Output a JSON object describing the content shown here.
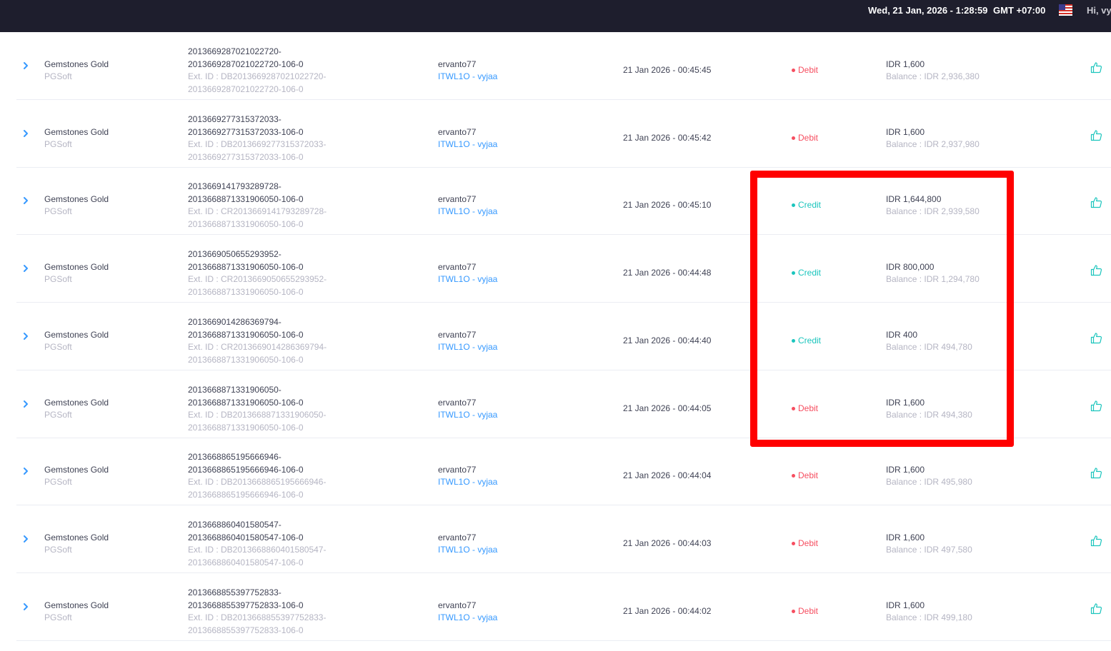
{
  "header": {
    "datetime": "Wed, 21 Jan, 2026 - 1:28:59",
    "timezone": "GMT +07:00",
    "language_flag": "us-flag-icon",
    "greeting": "Hi, vy"
  },
  "colors": {
    "topbar": "#1e1e2d",
    "debit": "#f64e60",
    "credit": "#1bc5bd",
    "link": "#3699ff",
    "highlight_box": "#ff0000"
  },
  "transactions": [
    {
      "game": "Gemstones Gold",
      "provider": "PGSoft",
      "tx_line1": "2013669287021022720-",
      "tx_line2": "2013669287021022720-106-0",
      "ext_line1": "Ext. ID : DB2013669287021022720-",
      "ext_line2": "2013669287021022720-106-0",
      "username": "ervanto77",
      "agent": "ITWL1O - vyjaa",
      "time": "21 Jan 2026 - 00:45:45",
      "type": "Debit",
      "type_class": "debit",
      "amount": "IDR 1,600",
      "balance": "Balance : IDR 2,936,380"
    },
    {
      "game": "Gemstones Gold",
      "provider": "PGSoft",
      "tx_line1": "2013669277315372033-",
      "tx_line2": "2013669277315372033-106-0",
      "ext_line1": "Ext. ID : DB2013669277315372033-",
      "ext_line2": "2013669277315372033-106-0",
      "username": "ervanto77",
      "agent": "ITWL1O - vyjaa",
      "time": "21 Jan 2026 - 00:45:42",
      "type": "Debit",
      "type_class": "debit",
      "amount": "IDR 1,600",
      "balance": "Balance : IDR 2,937,980"
    },
    {
      "game": "Gemstones Gold",
      "provider": "PGSoft",
      "tx_line1": "2013669141793289728-",
      "tx_line2": "2013668871331906050-106-0",
      "ext_line1": "Ext. ID : CR2013669141793289728-",
      "ext_line2": "2013668871331906050-106-0",
      "username": "ervanto77",
      "agent": "ITWL1O - vyjaa",
      "time": "21 Jan 2026 - 00:45:10",
      "type": "Credit",
      "type_class": "credit",
      "amount": "IDR 1,644,800",
      "balance": "Balance : IDR 2,939,580"
    },
    {
      "game": "Gemstones Gold",
      "provider": "PGSoft",
      "tx_line1": "2013669050655293952-",
      "tx_line2": "2013668871331906050-106-0",
      "ext_line1": "Ext. ID : CR2013669050655293952-",
      "ext_line2": "2013668871331906050-106-0",
      "username": "ervanto77",
      "agent": "ITWL1O - vyjaa",
      "time": "21 Jan 2026 - 00:44:48",
      "type": "Credit",
      "type_class": "credit",
      "amount": "IDR 800,000",
      "balance": "Balance : IDR 1,294,780"
    },
    {
      "game": "Gemstones Gold",
      "provider": "PGSoft",
      "tx_line1": "2013669014286369794-",
      "tx_line2": "2013668871331906050-106-0",
      "ext_line1": "Ext. ID : CR2013669014286369794-",
      "ext_line2": "2013668871331906050-106-0",
      "username": "ervanto77",
      "agent": "ITWL1O - vyjaa",
      "time": "21 Jan 2026 - 00:44:40",
      "type": "Credit",
      "type_class": "credit",
      "amount": "IDR 400",
      "balance": "Balance : IDR 494,780"
    },
    {
      "game": "Gemstones Gold",
      "provider": "PGSoft",
      "tx_line1": "2013668871331906050-",
      "tx_line2": "2013668871331906050-106-0",
      "ext_line1": "Ext. ID : DB2013668871331906050-",
      "ext_line2": "2013668871331906050-106-0",
      "username": "ervanto77",
      "agent": "ITWL1O - vyjaa",
      "time": "21 Jan 2026 - 00:44:05",
      "type": "Debit",
      "type_class": "debit",
      "amount": "IDR 1,600",
      "balance": "Balance : IDR 494,380"
    },
    {
      "game": "Gemstones Gold",
      "provider": "PGSoft",
      "tx_line1": "2013668865195666946-",
      "tx_line2": "2013668865195666946-106-0",
      "ext_line1": "Ext. ID : DB2013668865195666946-",
      "ext_line2": "2013668865195666946-106-0",
      "username": "ervanto77",
      "agent": "ITWL1O - vyjaa",
      "time": "21 Jan 2026 - 00:44:04",
      "type": "Debit",
      "type_class": "debit",
      "amount": "IDR 1,600",
      "balance": "Balance : IDR 495,980"
    },
    {
      "game": "Gemstones Gold",
      "provider": "PGSoft",
      "tx_line1": "2013668860401580547-",
      "tx_line2": "2013668860401580547-106-0",
      "ext_line1": "Ext. ID : DB2013668860401580547-",
      "ext_line2": "2013668860401580547-106-0",
      "username": "ervanto77",
      "agent": "ITWL1O - vyjaa",
      "time": "21 Jan 2026 - 00:44:03",
      "type": "Debit",
      "type_class": "debit",
      "amount": "IDR 1,600",
      "balance": "Balance : IDR 497,580"
    },
    {
      "game": "Gemstones Gold",
      "provider": "PGSoft",
      "tx_line1": "2013668855397752833-",
      "tx_line2": "2013668855397752833-106-0",
      "ext_line1": "Ext. ID : DB2013668855397752833-",
      "ext_line2": "2013668855397752833-106-0",
      "username": "ervanto77",
      "agent": "ITWL1O - vyjaa",
      "time": "21 Jan 2026 - 00:44:02",
      "type": "Debit",
      "type_class": "debit",
      "amount": "IDR 1,600",
      "balance": "Balance : IDR 499,180"
    }
  ]
}
